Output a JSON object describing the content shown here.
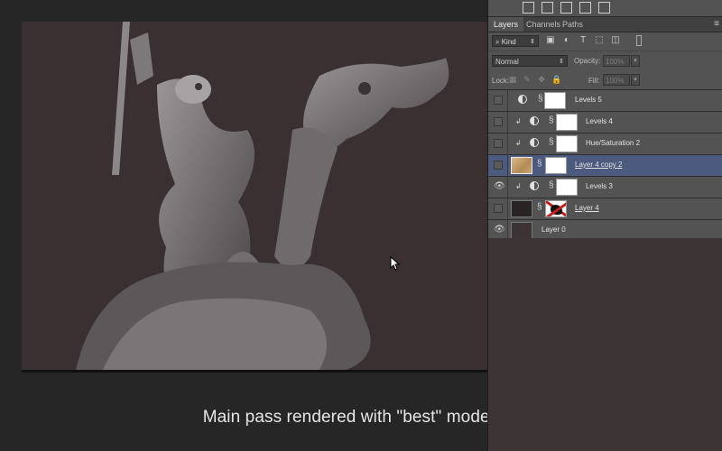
{
  "caption": "Main pass rendered with \"best\" mode only",
  "panel": {
    "tabs": [
      "Layers",
      "Channels",
      "Paths"
    ],
    "filter_kind": "Kind",
    "blend_mode": "Normal",
    "opacity_label": "Opacity:",
    "opacity_value": "100%",
    "lock_label": "Lock:",
    "fill_label": "Fill:",
    "fill_value": "100%"
  },
  "layers": [
    {
      "name": "Levels 5",
      "visible": false,
      "clipped": false,
      "type": "adjustment",
      "selected": false
    },
    {
      "name": "Levels 4",
      "visible": false,
      "clipped": true,
      "type": "adjustment",
      "selected": false
    },
    {
      "name": "Hue/Saturation 2",
      "visible": false,
      "clipped": true,
      "type": "adjustment",
      "selected": false
    },
    {
      "name": "Layer 4 copy 2",
      "visible": false,
      "clipped": false,
      "type": "pixel-mask",
      "selected": true
    },
    {
      "name": "Levels 3",
      "visible": true,
      "clipped": true,
      "type": "adjustment",
      "selected": false
    },
    {
      "name": "Layer 4",
      "visible": false,
      "clipped": false,
      "type": "pixel-redmask",
      "selected": false
    },
    {
      "name": "Layer 0",
      "visible": true,
      "clipped": false,
      "type": "pixel",
      "selected": false
    }
  ],
  "colors": {
    "canvas_bg": "#3a2f31",
    "panel_bg": "#535353",
    "selected_row": "#4d5a7f"
  }
}
